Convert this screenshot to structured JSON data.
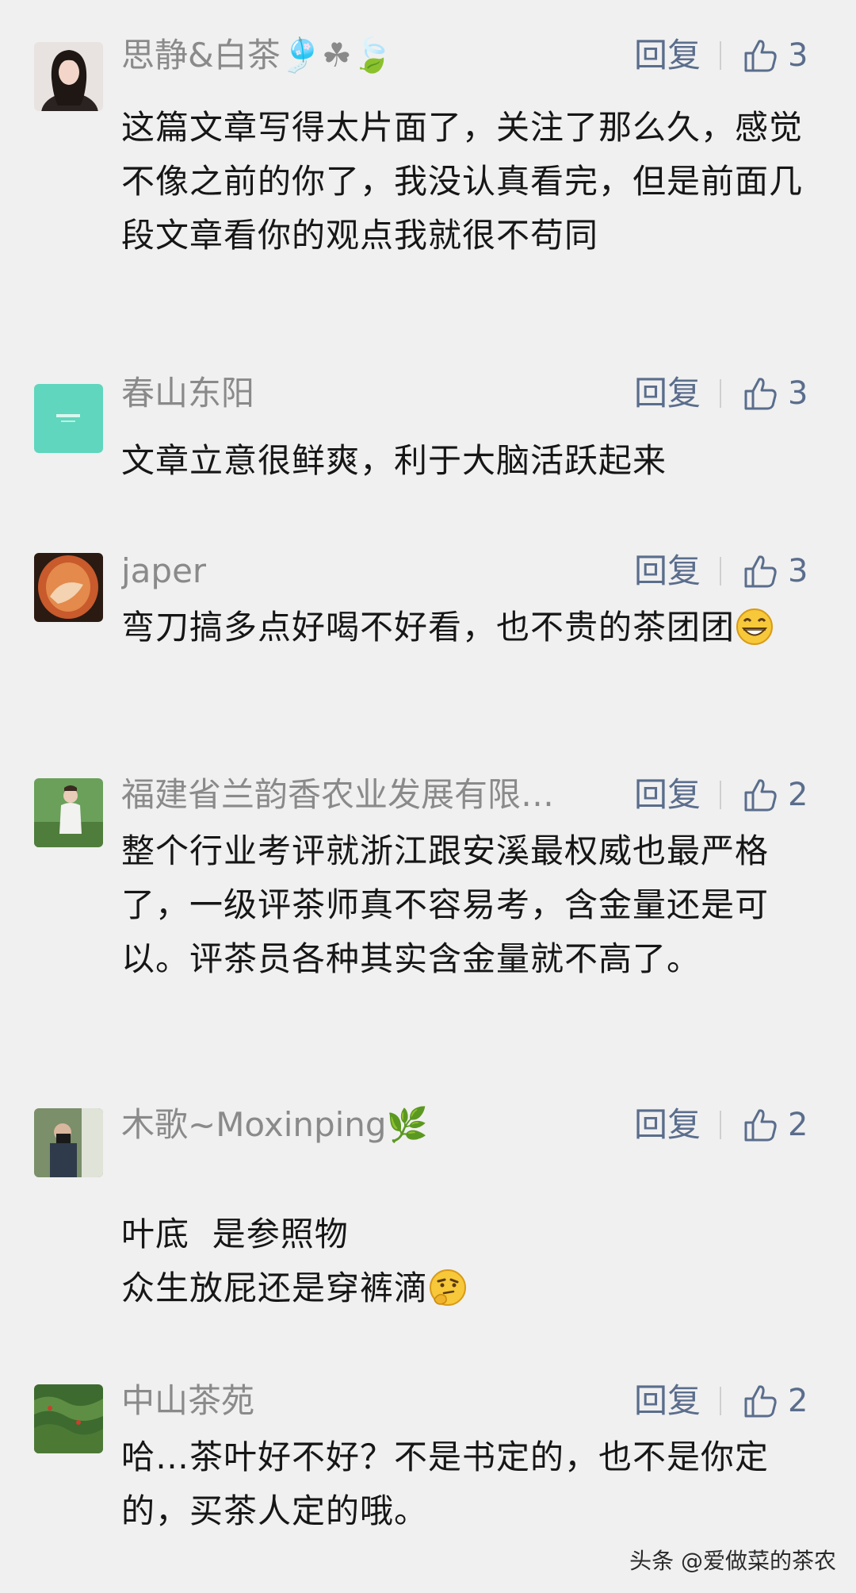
{
  "reply_label": "回复",
  "comments": [
    {
      "name": "思静&白茶🎐☘🍃",
      "likes": "3",
      "text": "这篇文章写得太片面了，关注了那么久，感觉不像之前的你了，我没认真看完，但是前面几段文章看你的观点我就很不苟同"
    },
    {
      "name": "春山东阳",
      "likes": "3",
      "text": "文章立意很鲜爽，利于大脑活跃起来"
    },
    {
      "name": "japer",
      "likes": "3",
      "text": "弯刀搞多点好喝不好看，也不贵的茶团团"
    },
    {
      "name": "福建省兰韵香农业发展有限…",
      "likes": "2",
      "text": "整个行业考评就浙江跟安溪最权威也最严格了，一级评茶师真不容易考，含金量还是可以。评茶员各种其实含金量就不高了。"
    },
    {
      "name": "木歌~Moxinping🌿",
      "likes": "2",
      "text_line1": "叶底  是参照物",
      "text_line2": "众生放屁还是穿裤滴"
    },
    {
      "name": "中山茶苑",
      "likes": "2",
      "text": "哈…茶叶好不好？不是书定的，也不是你定的，买茶人定的哦。"
    }
  ],
  "watermark": "头条 @爱做菜的茶农",
  "colors": {
    "background": "#f0f0f0",
    "name": "#8a8a8a",
    "action": "#5a6d8c",
    "text": "#161616"
  }
}
